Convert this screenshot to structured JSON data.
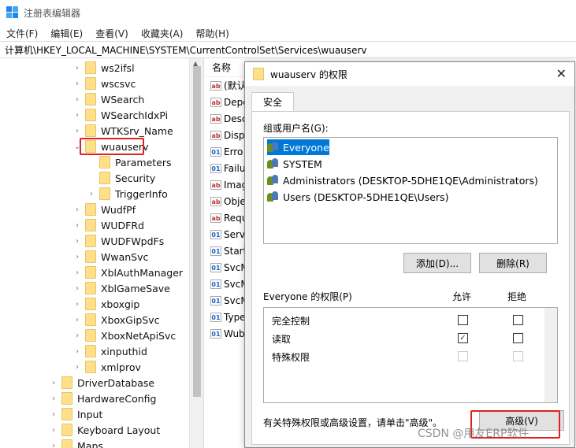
{
  "window": {
    "title": "注册表编辑器",
    "menu": [
      "文件(F)",
      "编辑(E)",
      "查看(V)",
      "收藏夹(A)",
      "帮助(H)"
    ],
    "address": "计算机\\HKEY_LOCAL_MACHINE\\SYSTEM\\CurrentControlSet\\Services\\wuauserv"
  },
  "tree": {
    "items": [
      {
        "label": "ws2ifsl",
        "indent": 1,
        "chevron": "›"
      },
      {
        "label": "wscsvc",
        "indent": 1,
        "chevron": "›"
      },
      {
        "label": "WSearch",
        "indent": 1,
        "chevron": "›"
      },
      {
        "label": "WSearchIdxPi",
        "indent": 1,
        "chevron": "›"
      },
      {
        "label": "WTKSrv_Name",
        "indent": 1,
        "chevron": "›"
      },
      {
        "label": "wuauserv",
        "indent": 1,
        "chevron": "⌄"
      },
      {
        "label": "Parameters",
        "indent": 2,
        "chevron": ""
      },
      {
        "label": "Security",
        "indent": 2,
        "chevron": ""
      },
      {
        "label": "TriggerInfo",
        "indent": 2,
        "chevron": "›"
      },
      {
        "label": "WudfPf",
        "indent": 1,
        "chevron": "›"
      },
      {
        "label": "WUDFRd",
        "indent": 1,
        "chevron": "›"
      },
      {
        "label": "WUDFWpdFs",
        "indent": 1,
        "chevron": "›"
      },
      {
        "label": "WwanSvc",
        "indent": 1,
        "chevron": "›"
      },
      {
        "label": "XblAuthManager",
        "indent": 1,
        "chevron": "›"
      },
      {
        "label": "XblGameSave",
        "indent": 1,
        "chevron": "›"
      },
      {
        "label": "xboxgip",
        "indent": 1,
        "chevron": "›"
      },
      {
        "label": "XboxGipSvc",
        "indent": 1,
        "chevron": "›"
      },
      {
        "label": "XboxNetApiSvc",
        "indent": 1,
        "chevron": "›"
      },
      {
        "label": "xinputhid",
        "indent": 1,
        "chevron": "›"
      },
      {
        "label": "xmlprov",
        "indent": 1,
        "chevron": "›"
      },
      {
        "label": "DriverDatabase",
        "indent": 0,
        "chevron": "›"
      },
      {
        "label": "HardwareConfig",
        "indent": 0,
        "chevron": "›"
      },
      {
        "label": "Input",
        "indent": 0,
        "chevron": "›"
      },
      {
        "label": "Keyboard Layout",
        "indent": 0,
        "chevron": "›"
      },
      {
        "label": "Maps",
        "indent": 0,
        "chevron": "›"
      }
    ]
  },
  "values": {
    "header": "名称",
    "rows": [
      {
        "label": "(默认",
        "type": "ab"
      },
      {
        "label": "Depe",
        "type": "ab"
      },
      {
        "label": "Desc",
        "type": "ab"
      },
      {
        "label": "Displ",
        "type": "ab"
      },
      {
        "label": "Erro",
        "type": "bin"
      },
      {
        "label": "Failu",
        "type": "bin"
      },
      {
        "label": "Imag",
        "type": "ab"
      },
      {
        "label": "Obje",
        "type": "ab"
      },
      {
        "label": "Requ",
        "type": "ab"
      },
      {
        "label": "Serv",
        "type": "bin"
      },
      {
        "label": "Start",
        "type": "bin"
      },
      {
        "label": "SvcM",
        "type": "bin"
      },
      {
        "label": "SvcM",
        "type": "bin"
      },
      {
        "label": "SvcM",
        "type": "bin"
      },
      {
        "label": "Type",
        "type": "bin"
      },
      {
        "label": "Wub",
        "type": "bin"
      }
    ]
  },
  "dialog": {
    "title": "wuauserv 的权限",
    "close": "✕",
    "tab": "安全",
    "group_label": "组或用户名(G):",
    "users": [
      {
        "name": "Everyone",
        "selected": true
      },
      {
        "name": "SYSTEM",
        "selected": false
      },
      {
        "name": "Administrators (DESKTOP-5DHE1QE\\Administrators)",
        "selected": false
      },
      {
        "name": "Users (DESKTOP-5DHE1QE\\Users)",
        "selected": false
      }
    ],
    "add_button": "添加(D)...",
    "remove_button": "删除(R)",
    "perm_label": "Everyone 的权限(P)",
    "allow_header": "允许",
    "deny_header": "拒绝",
    "permissions": [
      {
        "name": "完全控制",
        "allow": "",
        "deny": "",
        "disabled": false
      },
      {
        "name": "读取",
        "allow": "✓",
        "deny": "",
        "disabled": false
      },
      {
        "name": "特殊权限",
        "allow": "",
        "deny": "",
        "disabled": true
      }
    ],
    "advanced_hint": "有关特殊权限或高级设置，请单击\"高级\"。",
    "advanced_button": "高级(V)"
  },
  "watermark": "CSDN @用友ERP软件",
  "colors": {
    "selection": "#0078d7",
    "highlight_box": "#e02020",
    "folder": "#ffe08a"
  }
}
